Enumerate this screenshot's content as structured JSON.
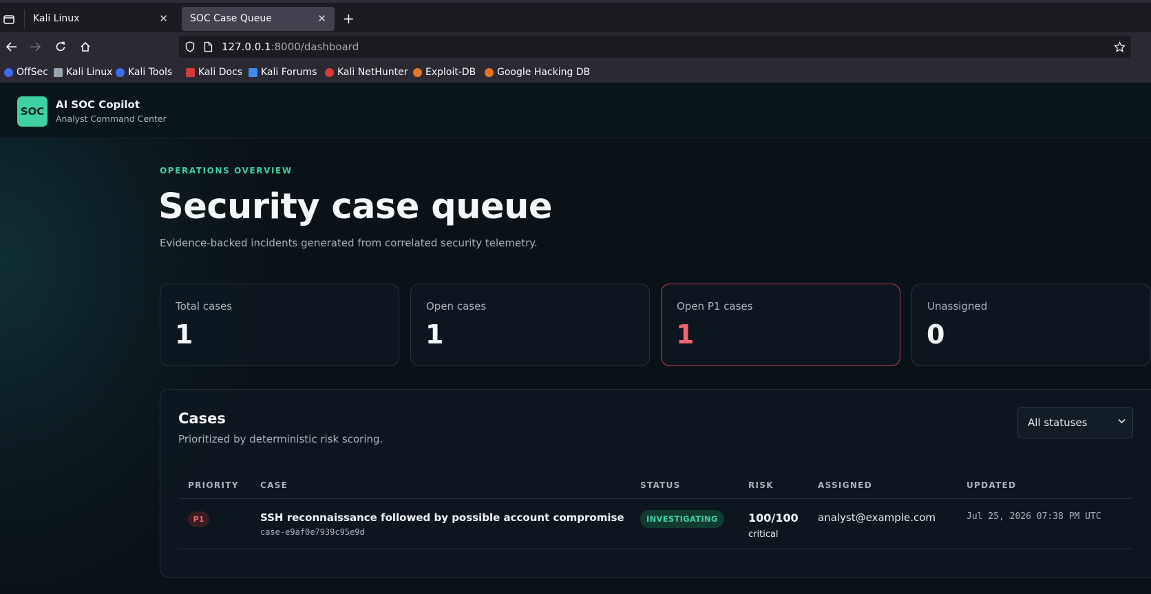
{
  "browser": {
    "tabs": [
      {
        "title": "Kali Linux",
        "active": false
      },
      {
        "title": "SOC Case Queue",
        "active": true
      }
    ],
    "url": {
      "host": "127.0.0.1",
      "rest": ":8000/dashboard"
    },
    "bookmarks": [
      {
        "label": "OffSec",
        "icon": "offsec-icon",
        "color": "#3b6cf0"
      },
      {
        "label": "Kali Linux",
        "icon": "kali-dragon-icon",
        "color": "#9aa5b3"
      },
      {
        "label": "Kali Tools",
        "icon": "kali-tools-icon",
        "color": "#3b6cf0"
      },
      {
        "label": "Kali Docs",
        "icon": "kali-docs-icon",
        "color": "#d83a3a"
      },
      {
        "label": "Kali Forums",
        "icon": "kali-forums-icon",
        "color": "#3b8cf0"
      },
      {
        "label": "Kali NetHunter",
        "icon": "nethunter-icon",
        "color": "#d83a3a"
      },
      {
        "label": "Exploit-DB",
        "icon": "exploit-db-icon",
        "color": "#e8741e"
      },
      {
        "label": "Google Hacking DB",
        "icon": "ghdb-icon",
        "color": "#e8741e"
      }
    ]
  },
  "app": {
    "logo": "SOC",
    "title": "AI SOC Copilot",
    "subtitle": "Analyst Command Center"
  },
  "page": {
    "eyebrow": "OPERATIONS OVERVIEW",
    "title": "Security case queue",
    "description": "Evidence-backed incidents generated from correlated security telemetry."
  },
  "stats": [
    {
      "label": "Total cases",
      "value": "1"
    },
    {
      "label": "Open cases",
      "value": "1"
    },
    {
      "label": "Open P1 cases",
      "value": "1"
    },
    {
      "label": "Unassigned",
      "value": "0"
    }
  ],
  "cases": {
    "title": "Cases",
    "subtitle": "Prioritized by deterministic risk scoring.",
    "filter": {
      "selected": "All statuses"
    },
    "columns": [
      "PRIORITY",
      "CASE",
      "STATUS",
      "RISK",
      "ASSIGNED",
      "UPDATED"
    ],
    "rows": [
      {
        "priority": "P1",
        "title": "SSH reconnaissance followed by possible account compromise",
        "id": "case-e9af0e7939c95e9d",
        "status": "INVESTIGATING",
        "risk_score": "100/100",
        "risk_level": "critical",
        "assigned": "analyst@example.com",
        "updated": "Jul 25, 2026 07:38 PM UTC"
      }
    ]
  },
  "colors": {
    "accent": "#3ed1a4",
    "alert": "#f0646e",
    "background": "#0b1218"
  }
}
